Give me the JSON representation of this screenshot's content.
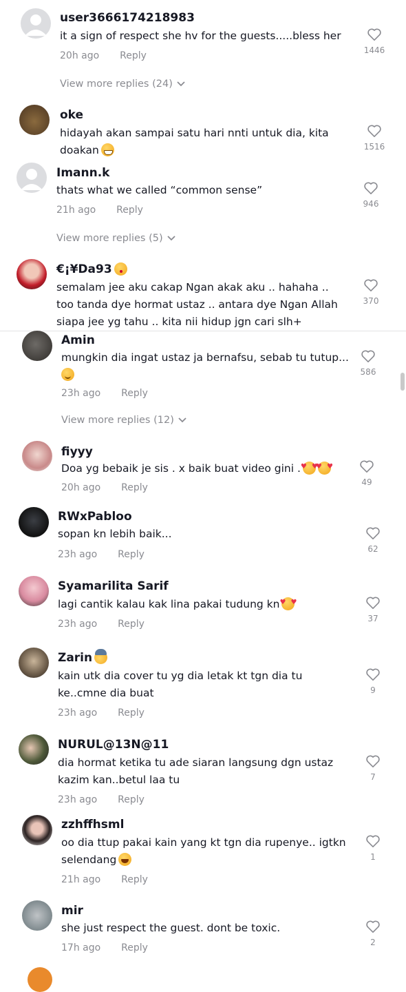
{
  "comments": [
    {
      "username": "user3666174218983",
      "text": "it a sign of respect she hv for the guests.....bless her",
      "emoji": "",
      "time": "20h ago",
      "reply": "Reply",
      "likes": "1446",
      "more": "View more replies (24)"
    },
    {
      "username": "oke",
      "text": "hidayah akan sampai satu hari nnti untuk dia, kita doakan",
      "emoji": "grin",
      "time": "",
      "reply": "",
      "likes": "1516",
      "more": ""
    },
    {
      "username": "Imann.k",
      "text": "thats what we called “common sense”",
      "emoji": "",
      "time": "21h ago",
      "reply": "Reply",
      "likes": "946",
      "more": "View more replies (5)"
    },
    {
      "username": "€¡¥Da93",
      "text": "semalam jee aku cakap Ngan akak aku .. hahaha .. too tanda dye hormat ustaz .. antara dye Ngan Allah siapa jee yg tahu .. kita nii hidup jgn cari slh+",
      "emoji": "",
      "name_emoji": "kiss",
      "time": "",
      "reply": "",
      "likes": "370",
      "more": ""
    },
    {
      "username": "Amin",
      "text": "mungkin dia ingat ustaz ja bernafsu, sebab tu tutup...",
      "emoji": "relief",
      "time": "23h ago",
      "reply": "Reply",
      "likes": "586",
      "more": "View more replies (12)"
    },
    {
      "username": "fiyyy",
      "text": "Doa yg bebaik je sis . x baik buat video gini .",
      "emoji": "hearts2",
      "time": "20h ago",
      "reply": "Reply",
      "likes": "49",
      "more": ""
    },
    {
      "username": "RWxPabloo",
      "text": "sopan kn lebih baik...",
      "emoji": "",
      "time": "23h ago",
      "reply": "Reply",
      "likes": "62",
      "more": ""
    },
    {
      "username": "Syamarilita Sarif",
      "text": "lagi cantik kalau kak lina pakai tudung kn",
      "emoji": "hearts",
      "time": "23h ago",
      "reply": "Reply",
      "likes": "37",
      "more": ""
    },
    {
      "username": "Zarin",
      "text": "kain utk dia cover tu yg dia letak kt tgn dia tu ke..cmne dia buat",
      "emoji": "",
      "name_emoji": "hat",
      "time": "23h ago",
      "reply": "Reply",
      "likes": "9",
      "more": ""
    },
    {
      "username": "NURUL@13N@11",
      "text": "dia hormat ketika tu ade siaran langsung dgn ustaz kazim kan..betul laa tu",
      "emoji": "",
      "time": "23h ago",
      "reply": "Reply",
      "likes": "7",
      "more": ""
    },
    {
      "username": "zzhffhsml",
      "text": "oo dia ttup pakai kain yang kt tgn dia rupenye.. igtkn selendang",
      "emoji": "laugh",
      "time": "21h ago",
      "reply": "Reply",
      "likes": "1",
      "more": ""
    },
    {
      "username": "mir",
      "text": "she just respect the guest. dont be toxic.",
      "emoji": "",
      "time": "17h ago",
      "reply": "Reply",
      "likes": "2",
      "more": ""
    }
  ],
  "colors": {
    "text": "#161823",
    "muted": "#8a8b91",
    "divider": "#e3e3e4"
  }
}
